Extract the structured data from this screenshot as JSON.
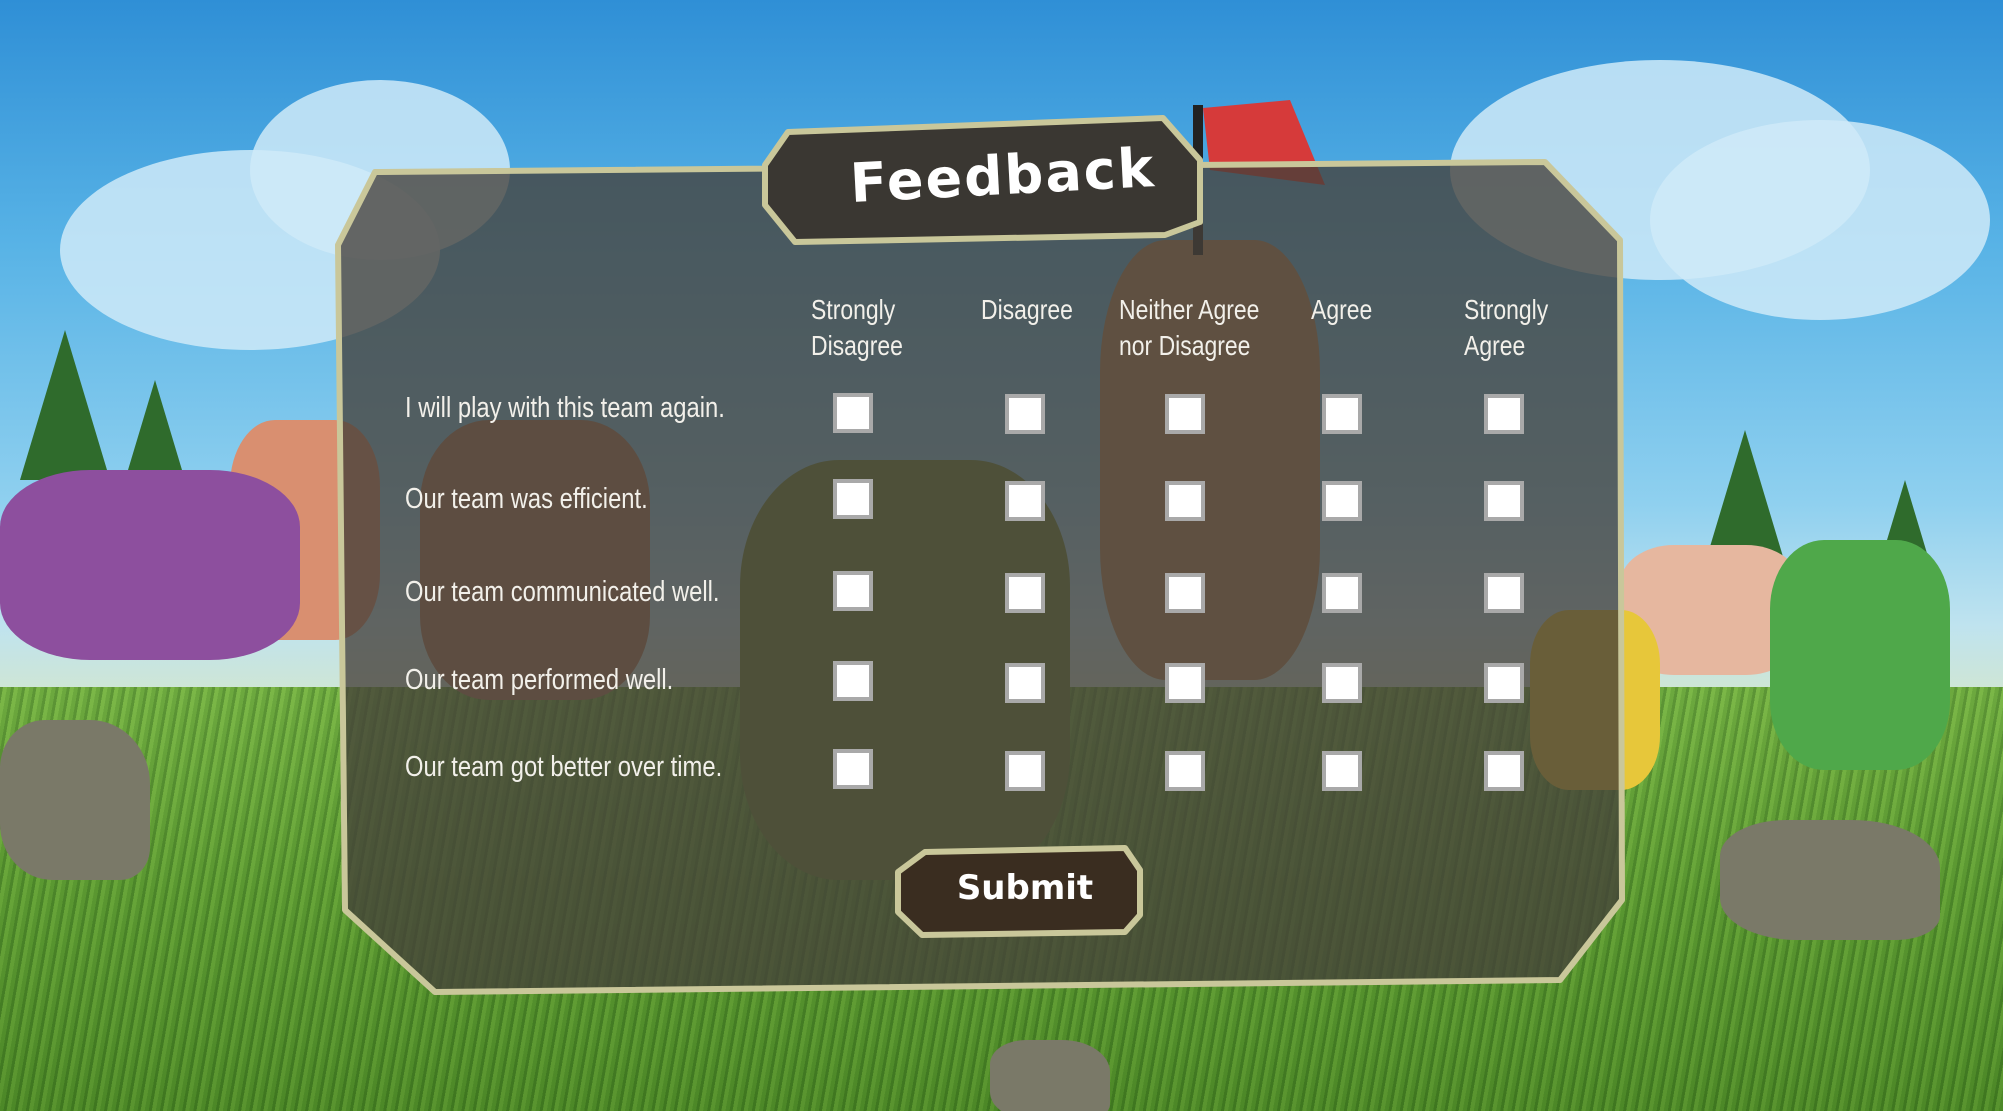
{
  "title": "Feedback",
  "columns": [
    {
      "line1": "Strongly",
      "line2": "Disagree"
    },
    {
      "line1": "Disagree",
      "line2": ""
    },
    {
      "line1": "Neither Agree",
      "line2": "nor Disagree"
    },
    {
      "line1": "Agree",
      "line2": ""
    },
    {
      "line1": "Strongly",
      "line2": "Agree"
    }
  ],
  "questions": [
    "I will play with this team again.",
    "Our team was efficient.",
    "Our team communicated well.",
    "Our team performed well.",
    "Our team got better over time."
  ],
  "submit_label": "Submit",
  "colors": {
    "panel_fill": "#45403a",
    "panel_border": "#c9c79a",
    "button_fill": "#3a2d20",
    "checkbox_border": "#a9a9a9"
  }
}
